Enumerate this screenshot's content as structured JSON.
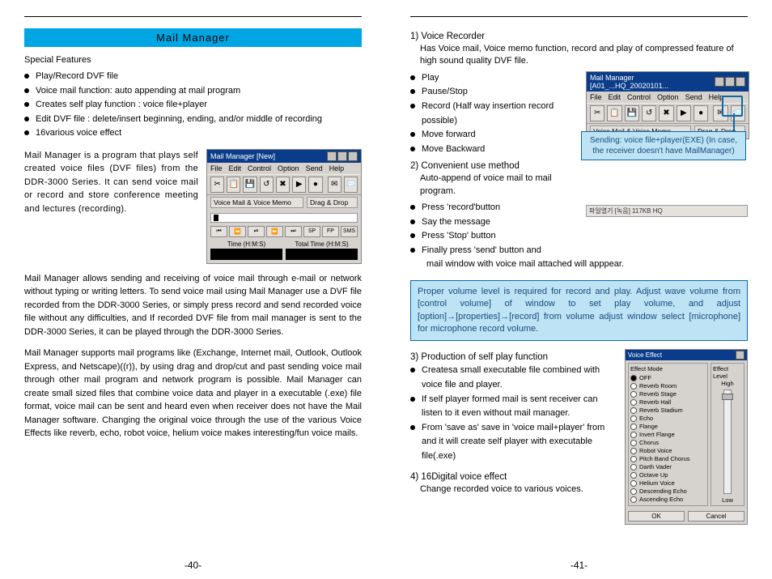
{
  "left": {
    "title": "Mail Manager",
    "featuresLabel": "Special Features",
    "features": [
      "Play/Record DVF file",
      "Voice mail function: auto appending at mail program",
      "Creates self play function : voice file+player",
      "Edit DVF file : delete/insert beginning, ending, and/or middle of recording",
      "16various voice effect"
    ],
    "para1": "Mail Manager is a program that plays self created voice files (DVF files) from the DDR-3000 Series. It can send voice mail or record and store conference meeting and lectures (recording).",
    "para2": "Mail Manager allows sending and receiving of voice mail through e-mail or network without typing or writing letters. To send voice mail using Mail Manager use a DVF file recorded from the DDR-3000 Series, or simply press record and send recorded voice file without any difficulties, and If recorded DVF file from mail manager is sent to the DDR-3000 Series, it can be played through the DDR-3000 Series.",
    "para3": "Mail Manager supports mail programs like (Exchange, Internet mail, Outlook, Outlook Express, and Netscape)((r)), by using drag and drop/cut and past sending voice mail through other mail program and network program is possible. Mail Manager can create small sized files that combine voice data and player in a executable (.exe) file format, voice mail can be sent and heard even when receiver does not have the Mail Manager software. Changing the original voice through the use of the various Voice Effects like reverb, echo, robot voice, helium voice makes interesting/fun voice mails.",
    "pageNum": "-40-"
  },
  "right": {
    "s1_h": "1) Voice Recorder",
    "s1_d": "Has Voice mail, Voice memo function, record and play of compressed feature of high sound quality DVF file.",
    "s1_list": [
      "Play",
      "Pause/Stop",
      "Record (Half way insertion record possible)",
      "Move forward",
      "Move Backward"
    ],
    "s2_h": "2) Convenient use method",
    "s2_d": "Auto-append of voice mail to mail program.",
    "s2_list": [
      "Press  'record'button",
      "Say the message",
      "Press 'Stop' button",
      "Finally press 'send' button and"
    ],
    "s2_tail": "mail window with voice mail attached will apppear.",
    "callout": "Sending: voice file+player(EXE)\n(In case, the receiver doesn't have MailManager)",
    "note": "Proper volume level is required for record and play. Adjust wave volume from [control volume] of window to set play volume, and adjust [option]→[properties]→[record] from volume adjust window select [microphone] for microphone record volume.",
    "s3_h": "3) Production of self play function",
    "s3_list": [
      "Createsa small executable file combined with voice file and player.",
      "If self player formed mail is sent receiver can listen to it even without mail manager.",
      "From 'save as' save in 'voice mail+player' from and it will create self player with executable file(.exe)"
    ],
    "s4_h": "4) 16Digital voice effect",
    "s4_d": "Change recorded voice to various voices.",
    "pageNum": "-41-"
  },
  "app": {
    "title": "Mail Manager [New]",
    "menu": [
      "File",
      "Edit",
      "Control",
      "Option",
      "Send",
      "Help"
    ],
    "sect1": "Voice Mail & Voice Memo",
    "sect2": "Drag & Drop",
    "ctrls": [
      "⏮",
      "⏪",
      "⏯",
      "⏩",
      "⏭",
      "SP",
      "FP",
      "SMS"
    ],
    "timeL": "Time (H:M:S)",
    "timeR": "Total Time (H:M:S)"
  },
  "app2": {
    "title": "Mail Manager [A01_...HQ_20020101...",
    "status": "파일열기   [녹음]   117KB       HQ"
  },
  "vfx": {
    "title": "Voice Effect",
    "group": "Effect Mode",
    "level": "Effect Level",
    "hi": "High",
    "lo": "Low",
    "items": [
      "OFF",
      "Reverb Room",
      "Reverb Stage",
      "Reverb Hall",
      "Reverb Stadium",
      "Echo",
      "Flange",
      "Invert Flange",
      "Chorus",
      "Robot Voice",
      "Pitch Band Chorus",
      "Darth Vader",
      "Octave Up",
      "Helium Voice",
      "Descending Echo",
      "Ascending Echo"
    ],
    "ok": "OK",
    "cancel": "Cancel"
  }
}
